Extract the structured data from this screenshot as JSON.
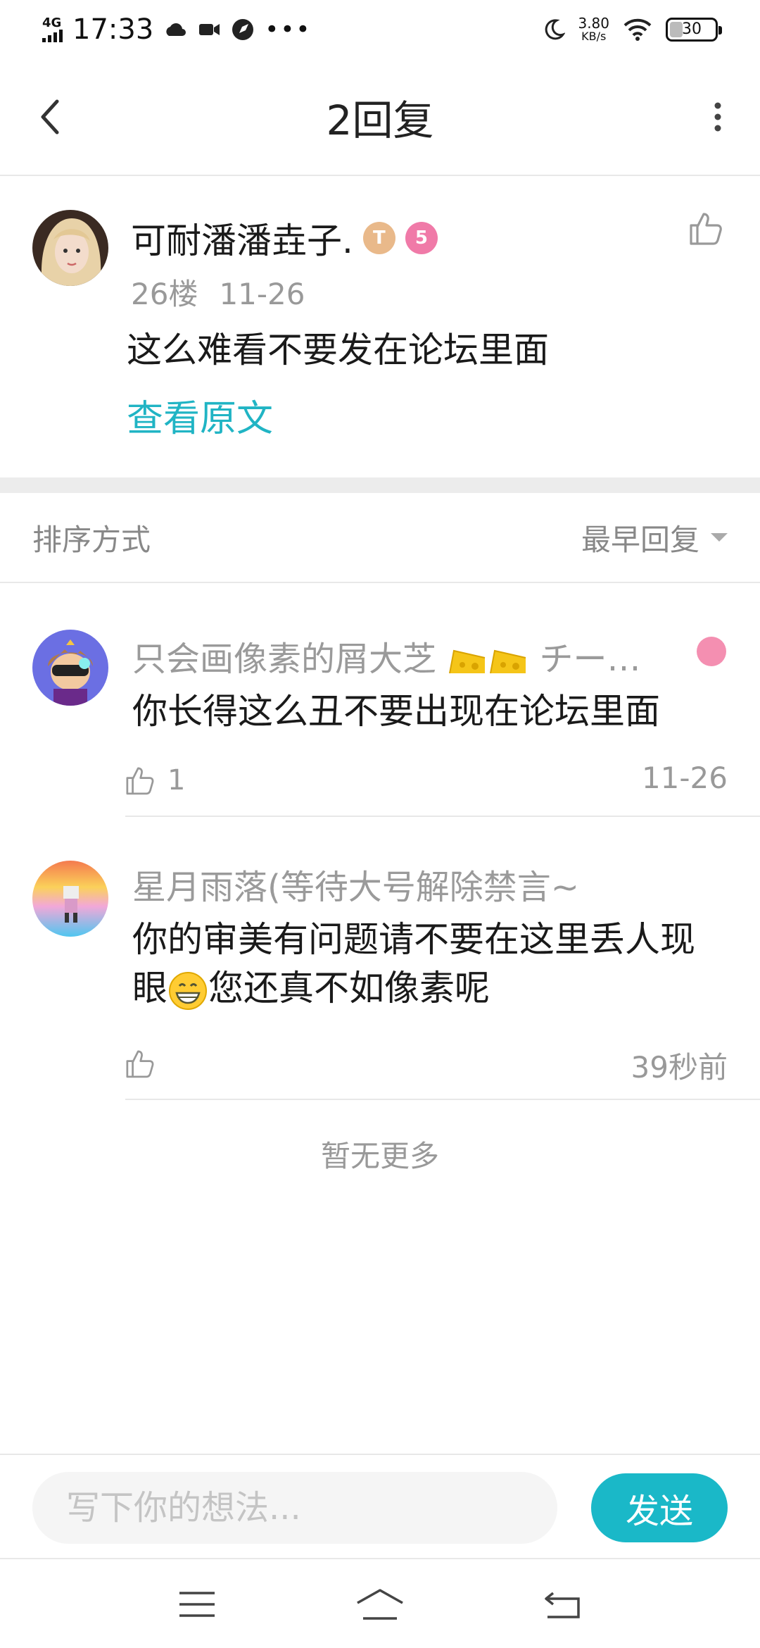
{
  "status_bar": {
    "network": "4G",
    "time": "17:33",
    "speed_value": "3.80",
    "speed_unit": "KB/s",
    "battery": "30"
  },
  "header": {
    "title": "2回复"
  },
  "post": {
    "author": "可耐潘潘垚子.",
    "badge_t": "T",
    "badge_level": "5",
    "floor": "26楼",
    "date": "11-26",
    "text": "这么难看不要发在论坛里面",
    "view_original": "查看原文"
  },
  "sort": {
    "label": "排序方式",
    "option": "最早回复"
  },
  "replies": [
    {
      "author_prefix": "只会画像素的屑大芝",
      "author_suffix": "チー…",
      "text": "你长得这么丑不要出现在论坛里面",
      "likes": "1",
      "time": "11-26"
    },
    {
      "author": "星月雨落(等待大号解除禁言~",
      "text_line1": "你的审美有问题请不要在这里丢人现",
      "text_line2_prefix": "眼",
      "text_line2_suffix": "您还真不如像素呢",
      "likes": "",
      "time": "39秒前"
    }
  ],
  "footer_note": "暂无更多",
  "composer": {
    "placeholder": "写下你的想法...",
    "send_label": "发送"
  },
  "colors": {
    "accent": "#1ab8c8",
    "link": "#20b4c4",
    "muted_text": "#999999",
    "divider": "#e8e8e8"
  }
}
